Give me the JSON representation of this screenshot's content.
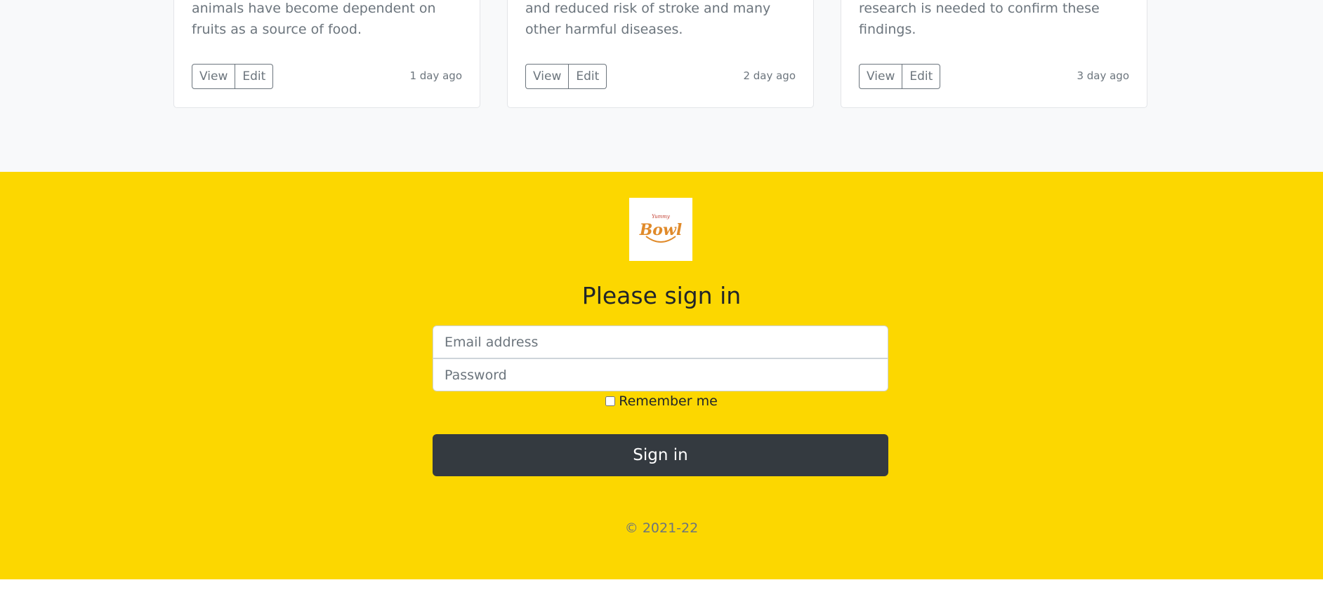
{
  "cards": [
    {
      "text": "and nutrition. In fact, humans and many animals have become dependent on fruits as a source of food.",
      "view_label": "View",
      "edit_label": "Edit",
      "time": "1 day ago"
    },
    {
      "text": "benefits, including improved gut health and reduced risk of stroke and many other harmful diseases.",
      "view_label": "View",
      "edit_label": "Edit",
      "time": "2 day ago"
    },
    {
      "text": "content of bananas. However, more research is needed to confirm these findings.",
      "view_label": "View",
      "edit_label": "Edit",
      "time": "3 day ago"
    }
  ],
  "signin": {
    "logo_text": "Bowl",
    "logo_small_text": "Yummy",
    "heading": "Please sign in",
    "email_placeholder": "Email address",
    "password_placeholder": "Password",
    "remember_label": "Remember me",
    "submit_label": "Sign in",
    "copyright": "© 2021-22"
  },
  "colors": {
    "footer_bg": "#fcd700",
    "button_dark": "#343a40",
    "muted": "#6c757d"
  }
}
